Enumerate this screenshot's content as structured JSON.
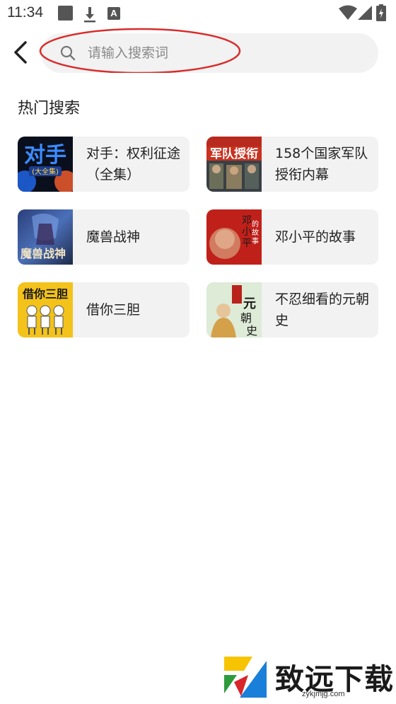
{
  "status_bar": {
    "time": "11:34",
    "icons": [
      "square-notification-icon",
      "download-icon",
      "a-notification-icon",
      "wifi-icon",
      "signal-icon",
      "battery-icon"
    ]
  },
  "search": {
    "placeholder": "请输入搜索词",
    "highlight_color": "#d92c2c"
  },
  "hot_search": {
    "title": "热门搜索",
    "items": [
      {
        "title": "对手：权利征途（全集）",
        "cover_text": "对手",
        "cover_sub": "(大全集)"
      },
      {
        "title": "158个国家军队授衔内幕",
        "cover_text": "军队授衔"
      },
      {
        "title": "魔兽战神",
        "cover_text": "魔兽战神"
      },
      {
        "title": "邓小平的故事",
        "cover_text": "邓小平的故事"
      },
      {
        "title": "借你三胆",
        "cover_text": "借你三胆"
      },
      {
        "title": "不忍细看的元朝史",
        "cover_text": "元朝史"
      }
    ]
  },
  "colors": {
    "card_bg": "#f2f2f2",
    "search_bg": "#f2f2f2",
    "text_primary": "#222222",
    "placeholder": "#8a8a8a"
  },
  "watermark": {
    "text": "致远下载",
    "url": "zykjmjg.com"
  }
}
